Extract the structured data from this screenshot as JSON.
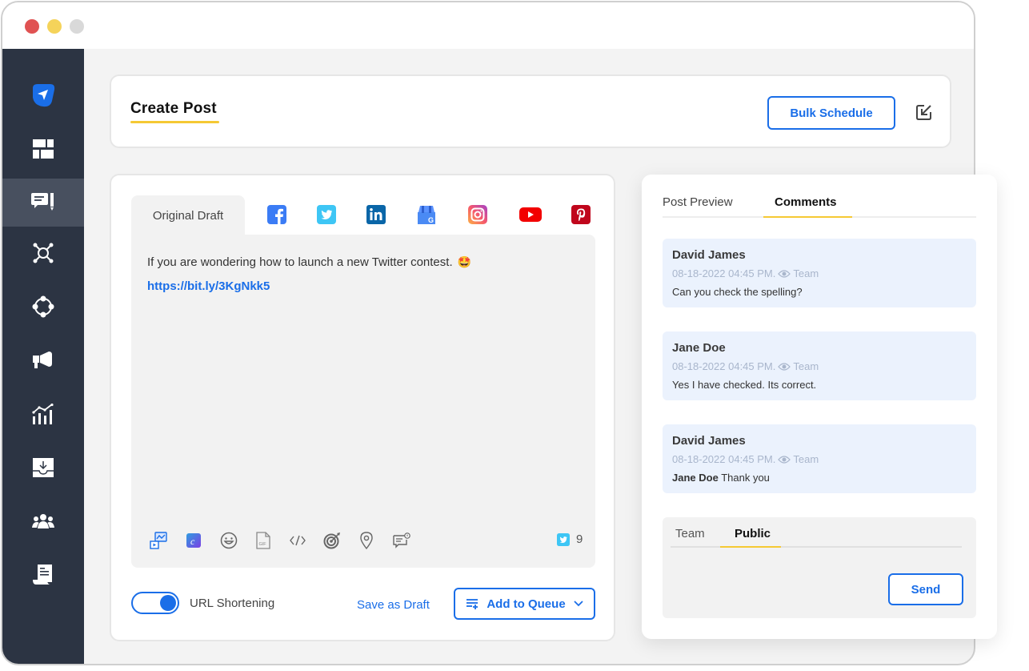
{
  "window": {
    "controls": [
      "close",
      "minimize",
      "maximize"
    ]
  },
  "sidebar": {
    "items": [
      {
        "icon": "paper-plane-logo-icon",
        "active": false
      },
      {
        "icon": "dashboard-icon",
        "active": false
      },
      {
        "icon": "compose-icon",
        "active": true
      },
      {
        "icon": "network-icon",
        "active": false
      },
      {
        "icon": "workflow-icon",
        "active": false
      },
      {
        "icon": "megaphone-icon",
        "active": false
      },
      {
        "icon": "analytics-icon",
        "active": false
      },
      {
        "icon": "inbox-download-icon",
        "active": false
      },
      {
        "icon": "team-icon",
        "active": false
      },
      {
        "icon": "report-icon",
        "active": false
      }
    ]
  },
  "header": {
    "title": "Create Post",
    "bulk_schedule_label": "Bulk Schedule",
    "export_icon": "export-arrow-icon"
  },
  "editor": {
    "draft_tab_label": "Original Draft",
    "networks": [
      "facebook",
      "twitter",
      "linkedin",
      "google-business",
      "instagram",
      "youtube",
      "pinterest"
    ],
    "post_text": "If you are wondering how to launch a new Twitter contest.",
    "post_emoji": "🤩",
    "post_link": "https://bit.ly/3KgNkk5",
    "tools": [
      "media-library-icon",
      "canva-icon",
      "emoji-icon",
      "gif-icon",
      "code-icon",
      "target-icon",
      "location-icon",
      "first-comment-icon"
    ],
    "char_count_network": "twitter",
    "char_count": "9",
    "url_shortening_label": "URL Shortening",
    "url_shortening_on": true,
    "save_draft_label": "Save as Draft",
    "add_queue_label": "Add to Queue"
  },
  "comments_panel": {
    "tabs": [
      {
        "label": "Post Preview",
        "active": false
      },
      {
        "label": "Comments",
        "active": true
      }
    ],
    "comments": [
      {
        "author": "David James",
        "timestamp": "08-18-2022 04:45 PM.",
        "visibility": "Team",
        "mention": "",
        "text": "Can you check the spelling?"
      },
      {
        "author": "Jane Doe",
        "timestamp": "08-18-2022 04:45 PM.",
        "visibility": "Team",
        "mention": "",
        "text": "Yes I have checked. Its correct."
      },
      {
        "author": "David James",
        "timestamp": "08-18-2022 04:45 PM.",
        "visibility": "Team",
        "mention": "Jane Doe",
        "text": "Thank you"
      }
    ],
    "reply": {
      "tabs": [
        {
          "label": "Team",
          "active": false
        },
        {
          "label": "Public",
          "active": true
        }
      ],
      "send_label": "Send"
    }
  },
  "colors": {
    "accent_blue": "#1a6ee8",
    "accent_yellow": "#f5c934",
    "sidebar_bg": "#2c3443",
    "sidebar_active": "#48505f",
    "comment_bg": "#ebf2fd"
  }
}
